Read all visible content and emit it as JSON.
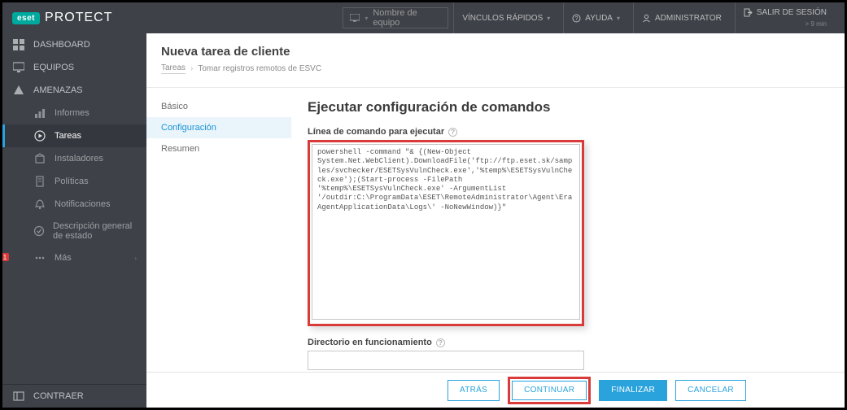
{
  "header": {
    "brand_badge": "eset",
    "brand_text": "PROTECT",
    "search_placeholder": "Nombre de equipo",
    "quick_links": "VÍNCULOS RÁPIDOS",
    "help": "AYUDA",
    "admin": "ADMINISTRATOR",
    "logout": "SALIR DE SESIÓN",
    "logout_sub": "> 9 min"
  },
  "sidebar": {
    "items": [
      {
        "label": "DASHBOARD"
      },
      {
        "label": "EQUIPOS"
      },
      {
        "label": "AMENAZAS"
      },
      {
        "label": "Informes"
      },
      {
        "label": "Tareas"
      },
      {
        "label": "Instaladores"
      },
      {
        "label": "Políticas"
      },
      {
        "label": "Notificaciones"
      },
      {
        "label": "Descripción general de estado"
      },
      {
        "label": "Más"
      }
    ],
    "collapse": "CONTRAER",
    "badge": "1"
  },
  "page": {
    "title": "Nueva tarea de cliente",
    "breadcrumb_root": "Tareas",
    "breadcrumb_leaf": "Tomar registros remotos de ESVC"
  },
  "subnav": {
    "items": [
      "Básico",
      "Configuración",
      "Resumen"
    ]
  },
  "form": {
    "section_title": "Ejecutar configuración de comandos",
    "cmd_label": "Línea de comando para ejecutar",
    "cmd_value": "powershell -command \"& {(New-Object System.Net.WebClient).DownloadFile('ftp://ftp.eset.sk/samples/svchecker/ESETSysVulnCheck.exe','%temp%\\ESETSysVulnCheck.exe');(Start-process -FilePath '%temp%\\ESETSysVulnCheck.exe' -ArgumentList '/outdir:C:\\ProgramData\\ESET\\RemoteAdministrator\\Agent\\EraAgentApplicationData\\Logs\\' -NoNewWindow)}\"",
    "dir_label": "Directorio en funcionamiento",
    "dir_value": ""
  },
  "buttons": {
    "back": "ATRÁS",
    "continue": "CONTINUAR",
    "finish": "FINALIZAR",
    "cancel": "CANCELAR"
  }
}
